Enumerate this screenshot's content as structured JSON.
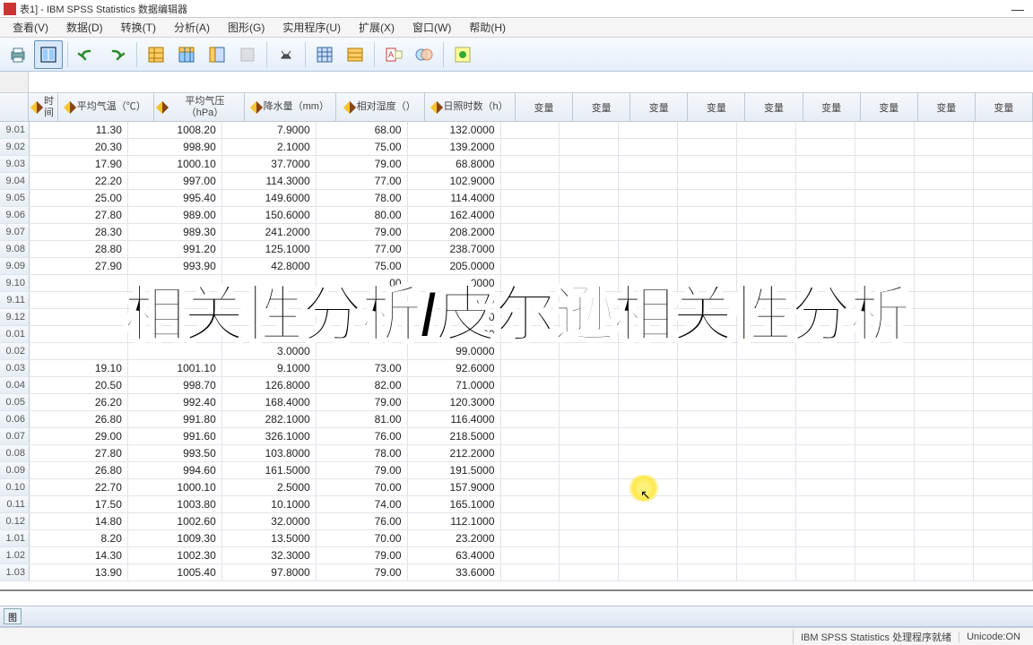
{
  "title": "表1] - IBM SPSS Statistics 数据编辑器",
  "menus": [
    "查看(V)",
    "数据(D)",
    "转换(T)",
    "分析(A)",
    "图形(G)",
    "实用程序(U)",
    "扩展(X)",
    "窗口(W)",
    "帮助(H)"
  ],
  "columns": [
    {
      "key": "time",
      "label": "时间",
      "pencil": true,
      "w": "w-time"
    },
    {
      "key": "c1",
      "label": "平均气温（℃）",
      "pencil": true,
      "w": "w-c1"
    },
    {
      "key": "c2",
      "label": "平均气压（hPa）",
      "pencil": true,
      "w": "w-c2"
    },
    {
      "key": "c3",
      "label": "降水量（mm）",
      "pencil": true,
      "w": "w-c3"
    },
    {
      "key": "c4",
      "label": "相对湿度（）",
      "pencil": true,
      "w": "w-c4"
    },
    {
      "key": "c5",
      "label": "日照时数（h）",
      "pencil": true,
      "w": "w-c5"
    }
  ],
  "empty_header": "变量",
  "empty_cols": 9,
  "rows": [
    {
      "h": "9.01",
      "v": [
        "11.30",
        "1008.20",
        "7.9000",
        "68.00",
        "132.0000"
      ]
    },
    {
      "h": "9.02",
      "v": [
        "20.30",
        "998.90",
        "2.1000",
        "75.00",
        "139.2000"
      ]
    },
    {
      "h": "9.03",
      "v": [
        "17.90",
        "1000.10",
        "37.7000",
        "79.00",
        "68.8000"
      ]
    },
    {
      "h": "9.04",
      "v": [
        "22.20",
        "997.00",
        "114.3000",
        "77.00",
        "102.9000"
      ]
    },
    {
      "h": "9.05",
      "v": [
        "25.00",
        "995.40",
        "149.6000",
        "78.00",
        "114.4000"
      ]
    },
    {
      "h": "9.06",
      "v": [
        "27.80",
        "989.00",
        "150.6000",
        "80.00",
        "162.4000"
      ]
    },
    {
      "h": "9.07",
      "v": [
        "28.30",
        "989.30",
        "241.2000",
        "79.00",
        "208.2000"
      ]
    },
    {
      "h": "9.08",
      "v": [
        "28.80",
        "991.20",
        "125.1000",
        "77.00",
        "238.7000"
      ]
    },
    {
      "h": "9.09",
      "v": [
        "27.90",
        "993.90",
        "42.8000",
        "75.00",
        "205.0000"
      ]
    },
    {
      "h": "9.10",
      "v": [
        "",
        "",
        "",
        "00",
        "0000"
      ]
    },
    {
      "h": "9.11",
      "v": [
        "",
        "",
        "",
        "",
        "000"
      ]
    },
    {
      "h": "9.12",
      "v": [
        "",
        "",
        "",
        "",
        "00"
      ]
    },
    {
      "h": "0.01",
      "v": [
        "",
        "",
        "",
        "",
        "000"
      ]
    },
    {
      "h": "0.02",
      "v": [
        "",
        "",
        "3.0000",
        "",
        "99.0000"
      ]
    },
    {
      "h": "0.03",
      "v": [
        "19.10",
        "1001.10",
        "9.1000",
        "73.00",
        "92.6000"
      ]
    },
    {
      "h": "0.04",
      "v": [
        "20.50",
        "998.70",
        "126.8000",
        "82.00",
        "71.0000"
      ]
    },
    {
      "h": "0.05",
      "v": [
        "26.20",
        "992.40",
        "168.4000",
        "79.00",
        "120.3000"
      ]
    },
    {
      "h": "0.06",
      "v": [
        "26.80",
        "991.80",
        "282.1000",
        "81.00",
        "116.4000"
      ]
    },
    {
      "h": "0.07",
      "v": [
        "29.00",
        "991.60",
        "326.1000",
        "76.00",
        "218.5000"
      ]
    },
    {
      "h": "0.08",
      "v": [
        "27.80",
        "993.50",
        "103.8000",
        "78.00",
        "212.2000"
      ]
    },
    {
      "h": "0.09",
      "v": [
        "26.80",
        "994.60",
        "161.5000",
        "79.00",
        "191.5000"
      ]
    },
    {
      "h": "0.10",
      "v": [
        "22.70",
        "1000.10",
        "2.5000",
        "70.00",
        "157.9000"
      ]
    },
    {
      "h": "0.11",
      "v": [
        "17.50",
        "1003.80",
        "10.1000",
        "74.00",
        "165.1000"
      ]
    },
    {
      "h": "0.12",
      "v": [
        "14.80",
        "1002.60",
        "32.0000",
        "76.00",
        "112.1000"
      ]
    },
    {
      "h": "1.01",
      "v": [
        "8.20",
        "1009.30",
        "13.5000",
        "70.00",
        "23.2000"
      ]
    },
    {
      "h": "1.02",
      "v": [
        "14.30",
        "1002.30",
        "32.3000",
        "79.00",
        "63.4000"
      ]
    },
    {
      "h": "1.03",
      "v": [
        "13.90",
        "1005.40",
        "97.8000",
        "79.00",
        "33.6000"
      ]
    }
  ],
  "watermark": "相关性分析/皮尔逊相关性分析",
  "status_left": "",
  "status_proc": "IBM SPSS Statistics 处理程序就绪",
  "status_unicode": "Unicode:ON",
  "view_tab": "图"
}
